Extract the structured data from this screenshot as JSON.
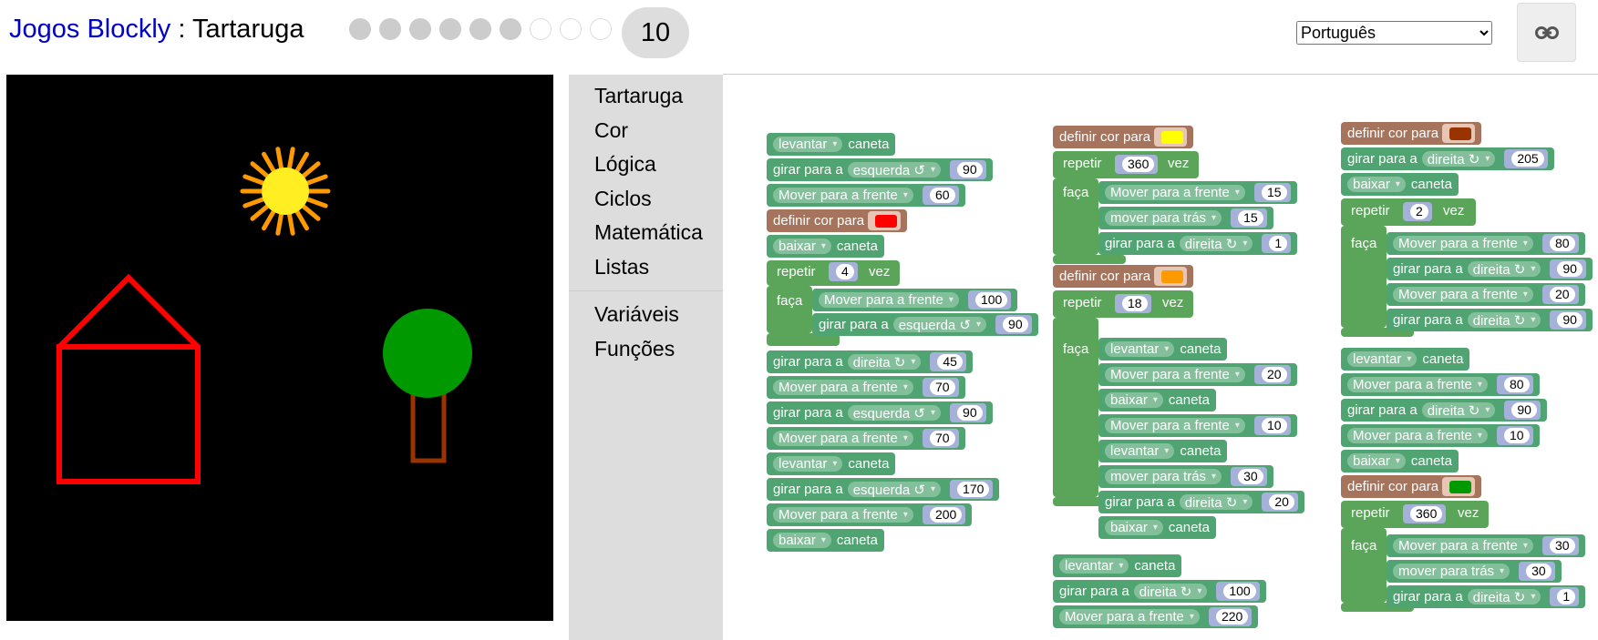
{
  "header": {
    "app_title": "Jogos Blockly",
    "separator": " : ",
    "page_title": "Tartaruga",
    "level_dots": [
      "done",
      "done",
      "done",
      "done",
      "done",
      "done",
      "todo",
      "todo",
      "todo"
    ],
    "current_level": "10",
    "language": "Português",
    "link_icon": "link-icon"
  },
  "toolbox": {
    "categories": [
      "Tartaruga",
      "Cor",
      "Lógica",
      "Ciclos",
      "Matemática",
      "Listas"
    ],
    "categories2": [
      "Variáveis",
      "Funções"
    ]
  },
  "colors": {
    "sun": "#ffee22",
    "sun_rays": "#ff9900",
    "house": "#ff0000",
    "tree_top": "#009900",
    "tree_trunk": "#993300",
    "swatch_red": "#ff0000",
    "swatch_yellow": "#ffff00",
    "swatch_orange": "#ff9900",
    "swatch_brown": "#993300",
    "swatch_green": "#009900"
  },
  "words": {
    "levantar": "levantar",
    "baixar": "baixar",
    "caneta": "caneta",
    "girar_para_a": "girar para a",
    "esquerda": "esquerda ↺",
    "direita": "direita ↻",
    "mover_frente": "Mover para a frente",
    "mover_frente_lc": "mover para a frente",
    "mover_tras": "mover para trás",
    "definir_cor": "definir cor para",
    "repetir": "repetir",
    "vez": "vez",
    "faca": "faça"
  },
  "values": {
    "s1_girar1": "90",
    "s1_mover1": "60",
    "s1_repetir": "4",
    "s1_mover2": "100",
    "s1_girar2": "90",
    "s1_girar3": "45",
    "s1_mover3": "70",
    "s1_girar4": "90",
    "s1_mover4": "70",
    "s1_girar5": "170",
    "s1_mover5": "200",
    "s2_repetir1": "360",
    "s2_mover1": "15",
    "s2_tras1": "15",
    "s2_girar1": "1",
    "s2_repetir2": "18",
    "s2_mover2": "20",
    "s2_mover3": "10",
    "s2_tras2": "30",
    "s2_girar2": "20",
    "s2_girar3": "100",
    "s2_mover4": "220",
    "s3_girar1": "205",
    "s3_repetir1": "2",
    "s3_mover1": "80",
    "s3_girar2": "90",
    "s3_mover2": "20",
    "s3_girar3": "90",
    "s3_mover3": "80",
    "s3_girar4": "90",
    "s3_mover4": "10",
    "s3_repetir2": "360",
    "s3_mover5": "30",
    "s3_tras1": "30",
    "s3_girar5": "1"
  }
}
